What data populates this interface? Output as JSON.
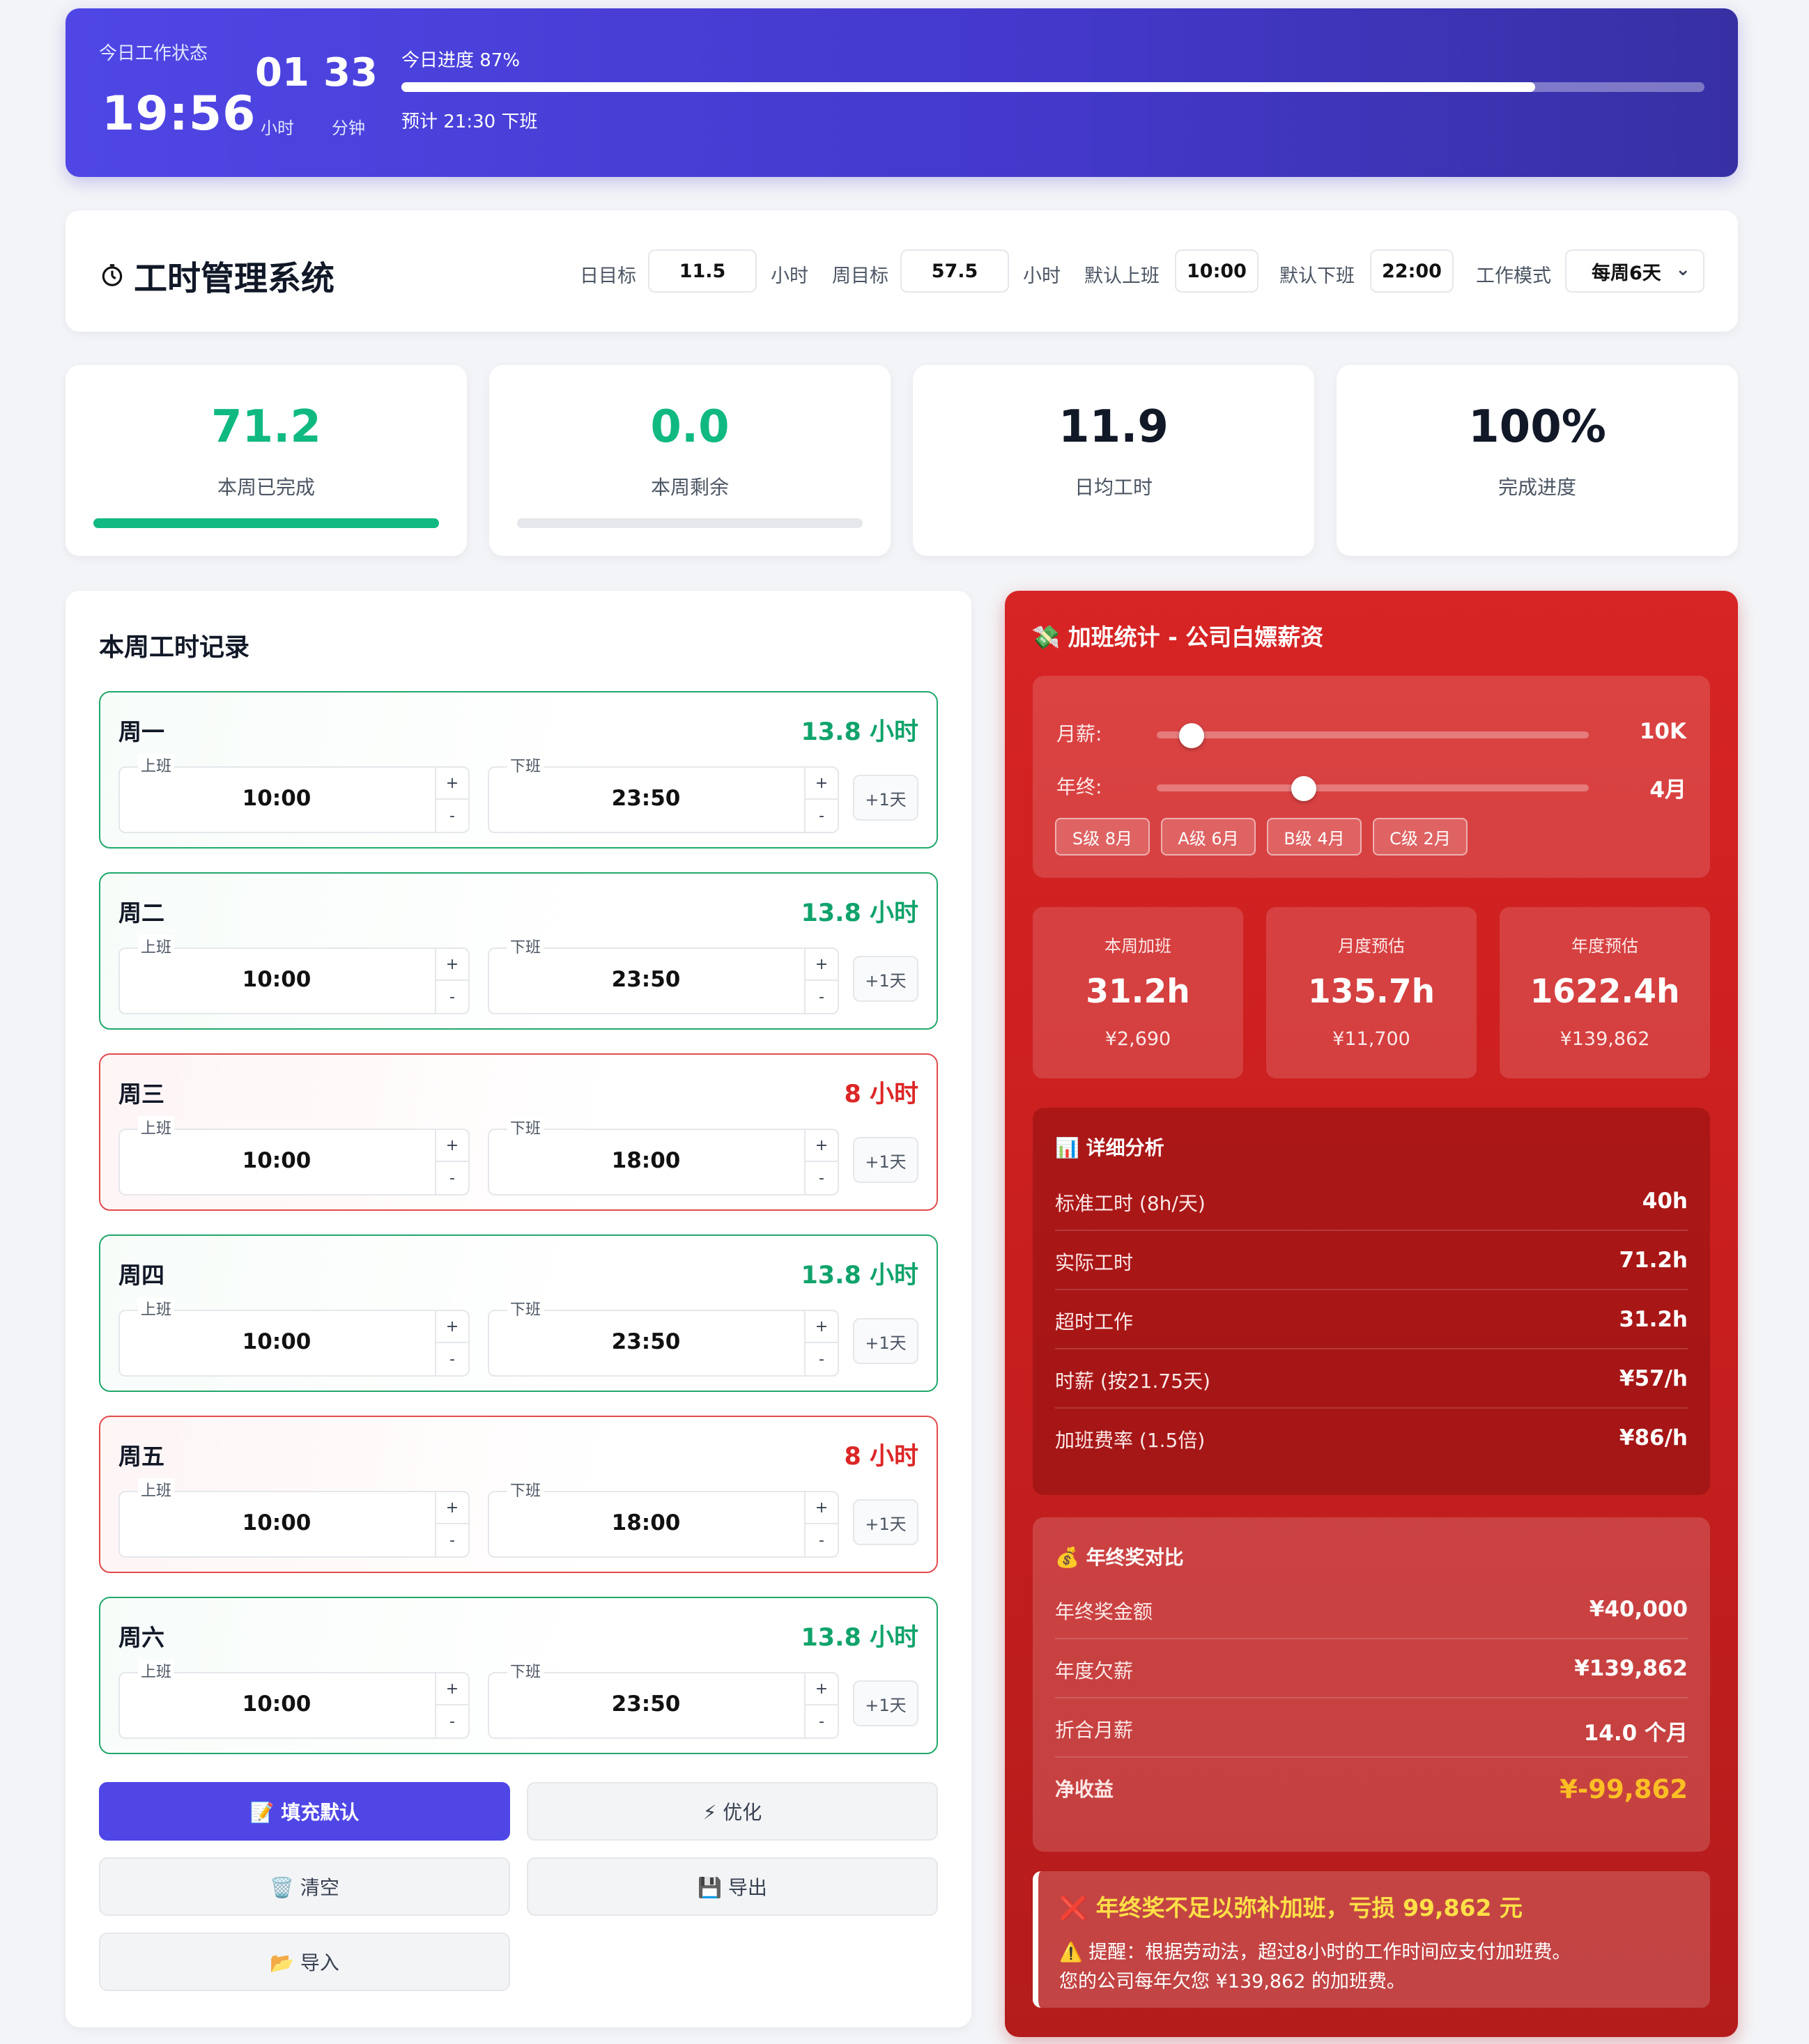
{
  "banner": {
    "status_label": "今日工作状态",
    "clock": "19:56",
    "hours": "01",
    "hours_unit": "小时",
    "minutes": "33",
    "minutes_unit": "分钟",
    "progress_label": "今日进度 87%",
    "progress_percent": 87,
    "eta": "预计 21:30 下班"
  },
  "header": {
    "title": "工时管理系统",
    "title_icon": "stopwatch-icon",
    "daily_target_label": "日目标",
    "daily_target_value": "11.5",
    "daily_unit": "小时",
    "weekly_target_label": "周目标",
    "weekly_target_value": "57.5",
    "weekly_unit": "小时",
    "default_start_label": "默认上班",
    "default_start_value": "10:00",
    "default_end_label": "默认下班",
    "default_end_value": "22:00",
    "mode_label": "工作模式",
    "mode_value": "每周6天"
  },
  "stats": [
    {
      "value": "71.2",
      "label": "本周已完成",
      "color": "#10b981",
      "bar_percent": 100,
      "has_bar": true
    },
    {
      "value": "0.0",
      "label": "本周剩余",
      "color": "#10b981",
      "bar_percent": 0,
      "has_bar": true
    },
    {
      "value": "11.9",
      "label": "日均工时",
      "color": "#111827",
      "has_bar": false
    },
    {
      "value": "100%",
      "label": "完成进度",
      "color": "#111827",
      "has_bar": false
    }
  ],
  "week": {
    "title": "本周工时记录",
    "start_label": "上班",
    "end_label": "下班",
    "plus_day": "+1天",
    "plus": "+",
    "minus": "-",
    "days": [
      {
        "name": "周一",
        "hours": "13.8 小时",
        "start": "10:00",
        "end": "23:50",
        "short": false
      },
      {
        "name": "周二",
        "hours": "13.8 小时",
        "start": "10:00",
        "end": "23:50",
        "short": false
      },
      {
        "name": "周三",
        "hours": "8 小时",
        "start": "10:00",
        "end": "18:00",
        "short": true
      },
      {
        "name": "周四",
        "hours": "13.8 小时",
        "start": "10:00",
        "end": "23:50",
        "short": false
      },
      {
        "name": "周五",
        "hours": "8 小时",
        "start": "10:00",
        "end": "18:00",
        "short": true
      },
      {
        "name": "周六",
        "hours": "13.8 小时",
        "start": "10:00",
        "end": "23:50",
        "short": false
      }
    ],
    "buttons": {
      "fill_default": "📝 填充默认",
      "optimize": "⚡ 优化",
      "clear": "🗑️ 清空",
      "export": "💾 导出",
      "import": "📂 导入"
    }
  },
  "overtime": {
    "title": "💸 加班统计 - 公司白嫖薪资",
    "salary_label": "月薪:",
    "salary_value": "10K",
    "salary_slider_fraction": 0.08,
    "bonus_label": "年终:",
    "bonus_value": "4月",
    "bonus_slider_fraction": 0.34,
    "chips": [
      "S级 8月",
      "A级 6月",
      "B级 4月",
      "C级 2月"
    ],
    "cards": [
      {
        "label": "本周加班",
        "hours": "31.2h",
        "money": "¥2,690"
      },
      {
        "label": "月度预估",
        "hours": "135.7h",
        "money": "¥11,700"
      },
      {
        "label": "年度预估",
        "hours": "1622.4h",
        "money": "¥139,862"
      }
    ],
    "analysis_title": "📊 详细分析",
    "analysis": [
      {
        "label": "标准工时 (8h/天)",
        "value": "40h"
      },
      {
        "label": "实际工时",
        "value": "71.2h"
      },
      {
        "label": "超时工作",
        "value": "31.2h"
      },
      {
        "label": "时薪 (按21.75天)",
        "value": "¥57/h"
      },
      {
        "label": "加班费率 (1.5倍)",
        "value": "¥86/h"
      }
    ],
    "bonus_title": "💰 年终奖对比",
    "bonus_rows": [
      {
        "label": "年终奖金额",
        "value": "¥40,000"
      },
      {
        "label": "年度欠薪",
        "value": "¥139,862"
      },
      {
        "label": "折合月薪",
        "value": "14.0 个月"
      },
      {
        "label": "净收益",
        "value": "¥-99,862"
      }
    ],
    "net_color": "#fbbf24",
    "warning_title": "❌ 年终奖不足以弥补加班，亏损 99,862 元",
    "warning_line1": "⚠️ 提醒：根据劳动法，超过8小时的工作时间应支付加班费。",
    "warning_line2": "您的公司每年欠您 ¥139,862 的加班费。"
  }
}
